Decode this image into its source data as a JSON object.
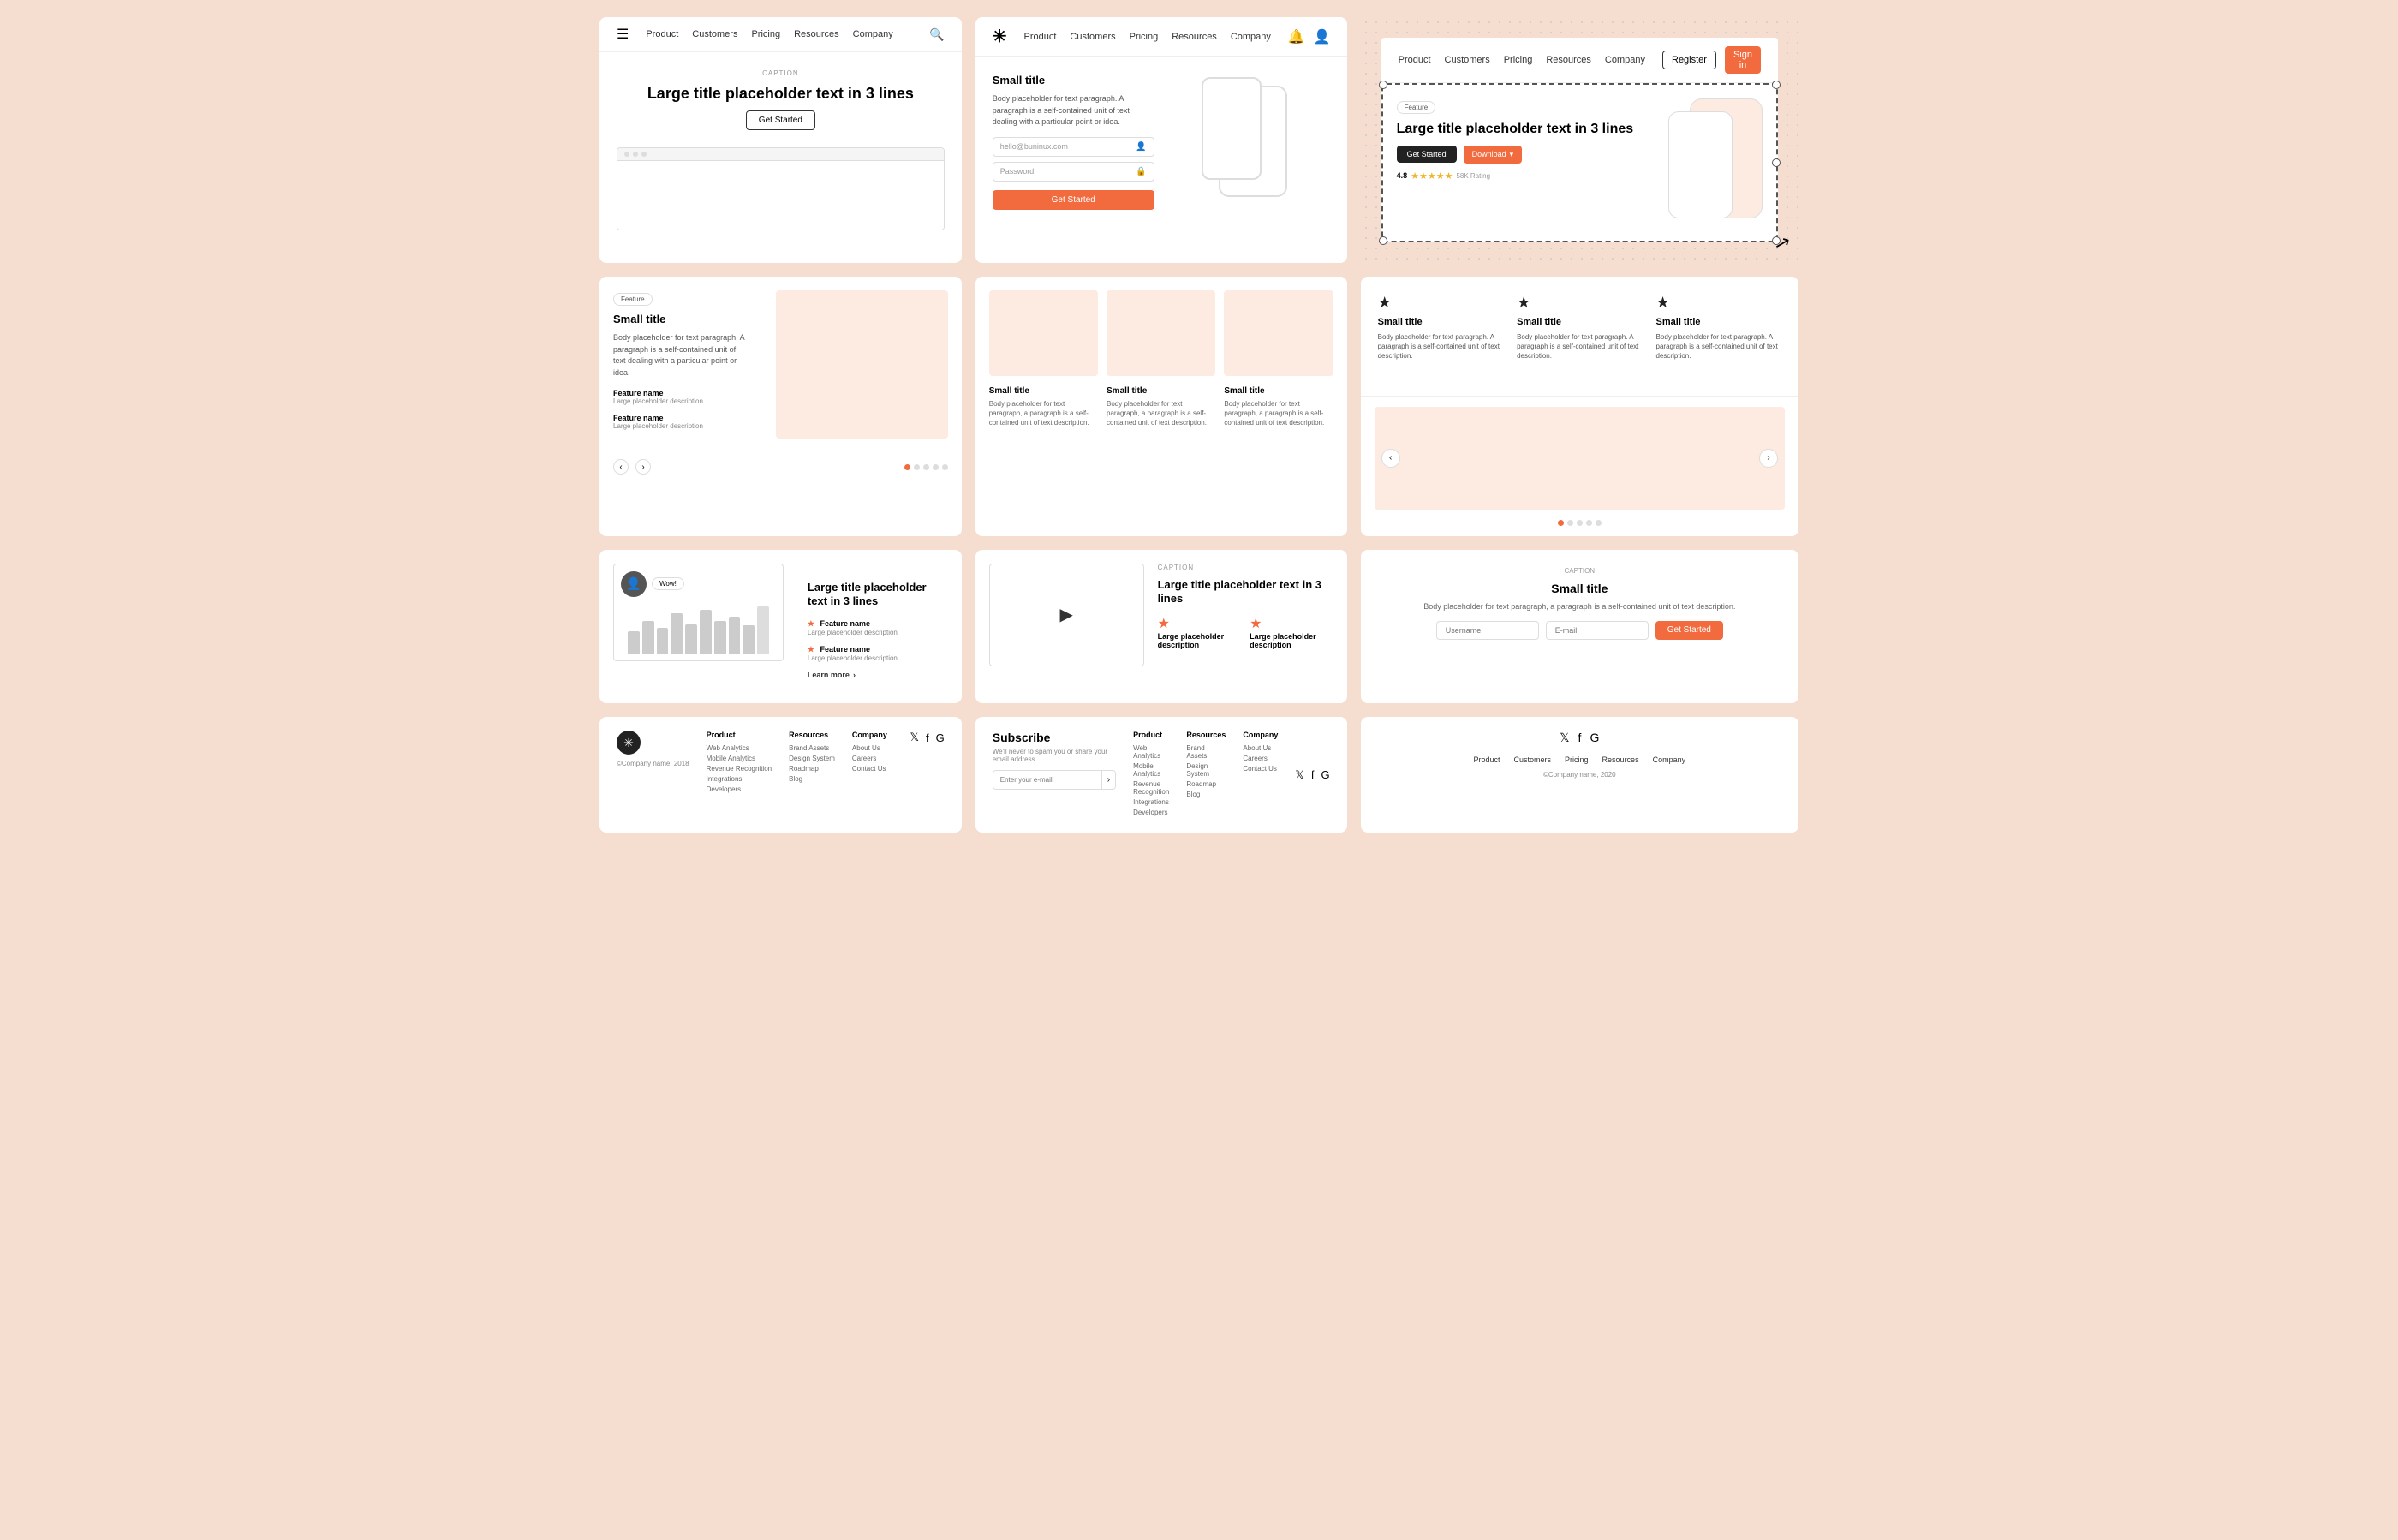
{
  "colors": {
    "orange": "#f26b3f",
    "light_pink": "#fdeae0",
    "dark": "#222222",
    "gray": "#888888",
    "border": "#dddddd"
  },
  "nav1": {
    "hamburger": "☰",
    "links": [
      "Product",
      "Customers",
      "Pricing",
      "Resources",
      "Company"
    ],
    "search_icon": "🔍"
  },
  "nav2": {
    "logo": "✳",
    "links": [
      "Product",
      "Customers",
      "Pricing",
      "Resources",
      "Company"
    ],
    "bell_icon": "🔔",
    "avatar_icon": "👤"
  },
  "nav3": {
    "links": [
      "Product",
      "Customers",
      "Pricing",
      "Resources",
      "Company"
    ],
    "register_label": "Register",
    "signin_label": "Sign in"
  },
  "card1": {
    "caption": "CAPTION",
    "title": "Large title placeholder text in 3 lines",
    "cta": "Get Started"
  },
  "card2": {
    "title": "Small title",
    "body": "Body placeholder for text paragraph. A paragraph is a self-contained unit of text dealing with a particular point or idea.",
    "email_placeholder": "hello@buninux.com",
    "password_placeholder": "Password",
    "cta": "Get Started"
  },
  "card3": {
    "feature_badge": "Feature",
    "title": "Large title placeholder text in 3 lines",
    "get_started": "Get Started",
    "download": "Download",
    "rating": "4.8",
    "stars": "★★★★★",
    "rating_count": "58K Rating"
  },
  "card4": {
    "feature_badge": "Feature",
    "title": "Small title",
    "body": "Body placeholder for text paragraph. A paragraph is a self-contained unit of text dealing with a particular point or idea.",
    "feature1_name": "Feature name",
    "feature1_desc": "Large placeholder description",
    "feature2_name": "Feature name",
    "feature2_desc": "Large placeholder description"
  },
  "card5": {
    "col1_title": "Small title",
    "col1_body": "Body placeholder for text paragraph, a paragraph is a self-contained unit of text description.",
    "col2_title": "Small title",
    "col2_body": "Body placeholder for text paragraph, a paragraph is a self-contained unit of text description.",
    "col3_title": "Small title",
    "col3_body": "Body placeholder for text paragraph, a paragraph is a self-contained unit of text description."
  },
  "card6": {
    "reviews": [
      {
        "star": "★",
        "title": "Small title",
        "body": "Body placeholder for text paragraph. A paragraph is a self-contained unit of text description."
      },
      {
        "star": "★",
        "title": "Small title",
        "body": "Body placeholder for text paragraph. A paragraph is a self-contained unit of text description."
      },
      {
        "star": "★",
        "title": "Small title",
        "body": "Body placeholder for text paragraph. A paragraph is a self-contained unit of text description."
      }
    ]
  },
  "card7": {
    "dots": 5
  },
  "card8": {
    "title": "Large title placeholder text in 3 lines",
    "wow_badge": "Wow!",
    "feature1_name": "Feature name",
    "feature1_desc": "Large placeholder description",
    "feature2_name": "Feature name",
    "feature2_desc": "Large placeholder description",
    "learn_more": "Learn more",
    "bars": [
      30,
      45,
      35,
      55,
      40,
      60,
      45,
      50,
      38,
      65
    ]
  },
  "card9": {
    "caption": "CAPTION",
    "title": "Large title placeholder text in 3 lines",
    "feat1_name": "Large placeholder description",
    "feat2_name": "Large placeholder description"
  },
  "card10": {
    "caption": "CAPTION",
    "title": "Small title",
    "body": "Body placeholder for text paragraph, a paragraph is a self-contained unit of text description.",
    "username_placeholder": "Username",
    "email_placeholder": "E-mail",
    "cta": "Get Started"
  },
  "footer1": {
    "logo": "✳",
    "copyright": "©Company name, 2018",
    "col1_title": "Product",
    "col1_items": [
      "Web Analytics",
      "Mobile Analytics",
      "Revenue Recognition",
      "Integrations",
      "Developers"
    ],
    "col2_title": "Resources",
    "col2_items": [
      "Brand Assets",
      "Design System",
      "Roadmap",
      "Blog"
    ],
    "col3_title": "Company",
    "col3_items": [
      "About Us",
      "Careers",
      "Contact Us"
    ],
    "social_twitter": "𝕏",
    "social_facebook": "f",
    "social_google": "G"
  },
  "footer2": {
    "subscribe_title": "Subscribe",
    "subscribe_desc": "We'll never to spam you or share your email address.",
    "subscribe_placeholder": "Enter your e-mail",
    "col1_title": "Product",
    "col1_items": [
      "Web Analytics",
      "Mobile Analytics",
      "Revenue Recognition",
      "Integrations",
      "Developers"
    ],
    "col2_title": "Resources",
    "col2_items": [
      "Brand Assets",
      "Design System",
      "Roadmap",
      "Blog"
    ],
    "col3_title": "Company",
    "col3_items": [
      "About Us",
      "Careers",
      "Contact Us"
    ],
    "social_twitter": "𝕏",
    "social_facebook": "f",
    "social_google": "G"
  },
  "footer3": {
    "social_twitter": "𝕏",
    "social_facebook": "f",
    "social_google": "G",
    "nav_links": [
      "Product",
      "Customers",
      "Pricing",
      "Resources",
      "Company"
    ],
    "copyright": "©Company name, 2020"
  }
}
